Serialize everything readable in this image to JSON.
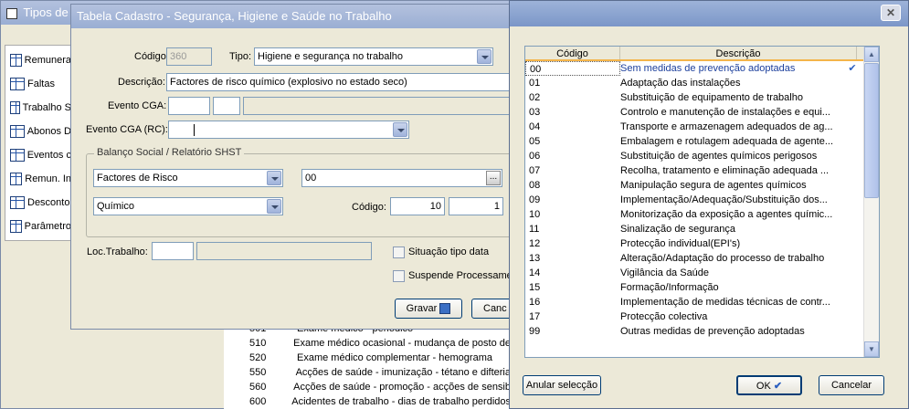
{
  "bg_window": {
    "title": "Tipos de",
    "items": [
      {
        "label": "Remunera",
        "icon": "table-icon"
      },
      {
        "label": "Faltas",
        "icon": "table-icon"
      },
      {
        "label": "Trabalho S",
        "icon": "table-icon"
      },
      {
        "label": "Abonos D",
        "icon": "table-icon"
      },
      {
        "label": "Eventos c",
        "icon": "table-icon"
      },
      {
        "label": "Remun. In",
        "icon": "table-icon"
      },
      {
        "label": "Desconto",
        "icon": "table-icon"
      },
      {
        "label": "Parâmetro",
        "icon": "table-icon"
      }
    ],
    "grid_rows": [
      {
        "code": "501",
        "desc": "Exame médico - periódico"
      },
      {
        "code": "510",
        "desc": "Exame médico ocasional - mudança de posto de"
      },
      {
        "code": "520",
        "desc": "Exame médico complementar - hemograma"
      },
      {
        "code": "550",
        "desc": "Acções de saúde - imunização - tétano e difteria"
      },
      {
        "code": "560",
        "desc": "Acções de saúde - promoção - acções de sensib"
      },
      {
        "code": "600",
        "desc": "Acidentes de trabalho - dias de trabalho perdidos"
      }
    ]
  },
  "form": {
    "title": "Tabela Cadastro - Segurança, Higiene e  Saúde no Trabalho",
    "codigo_label": "Código:",
    "codigo_value": "360",
    "tipo_label": "Tipo:",
    "tipo_value": "Higiene e segurança no trabalho",
    "descricao_label": "Descrição:",
    "descricao_value": "Factores de risco químico (explosivo no estado seco)",
    "evento_cga_label": "Evento CGA:",
    "evento_cga_rc_label": "Evento CGA (RC):",
    "group_label": "Balanço Social / Relatório SHST",
    "factores_value": "Factores de Risco",
    "factores_code_value": "00",
    "quimico_value": "Químico",
    "codigo2_label": "Código:",
    "codigo2_a": "10",
    "codigo2_b": "1",
    "loc_label": "Loc.Trabalho:",
    "situacao_label": "Situação tipo data",
    "suspende_label": "Suspende Processame",
    "gravar_label": "Gravar",
    "cancel_partial": "Canc"
  },
  "lookup": {
    "col_codigo": "Código",
    "col_descricao": "Descrição",
    "col_q": "?",
    "rows": [
      {
        "code": "00",
        "desc": "Sem medidas de prevenção adoptadas",
        "selected": true
      },
      {
        "code": "01",
        "desc": "Adaptação das instalações"
      },
      {
        "code": "02",
        "desc": "Substituição de equipamento de trabalho"
      },
      {
        "code": "03",
        "desc": "Controlo e manutenção de instalações e equi..."
      },
      {
        "code": "04",
        "desc": "Transporte e armazenagem adequados de ag..."
      },
      {
        "code": "05",
        "desc": "Embalagem e rotulagem adequada de agente..."
      },
      {
        "code": "06",
        "desc": "Substituição de agentes químicos perigosos"
      },
      {
        "code": "07",
        "desc": "Recolha, tratamento e eliminação adequada ..."
      },
      {
        "code": "08",
        "desc": "Manipulação segura de agentes químicos"
      },
      {
        "code": "09",
        "desc": "Implementação/Adequação/Substituição dos..."
      },
      {
        "code": "10",
        "desc": "Monitorização da exposição a agentes químic..."
      },
      {
        "code": "11",
        "desc": "Sinalização de segurança"
      },
      {
        "code": "12",
        "desc": "Protecção individual(EPI's)"
      },
      {
        "code": "13",
        "desc": "Alteração/Adaptação do processo de trabalho"
      },
      {
        "code": "14",
        "desc": "Vigilância da Saúde"
      },
      {
        "code": "15",
        "desc": "Formação/Informação"
      },
      {
        "code": "16",
        "desc": "Implementação de medidas técnicas de contr..."
      },
      {
        "code": "17",
        "desc": "Protecção colectiva"
      },
      {
        "code": "99",
        "desc": "Outras medidas de prevenção adoptadas"
      }
    ],
    "anular_label": "Anular selecção",
    "ok_label": "OK",
    "cancelar_label": "Cancelar"
  }
}
